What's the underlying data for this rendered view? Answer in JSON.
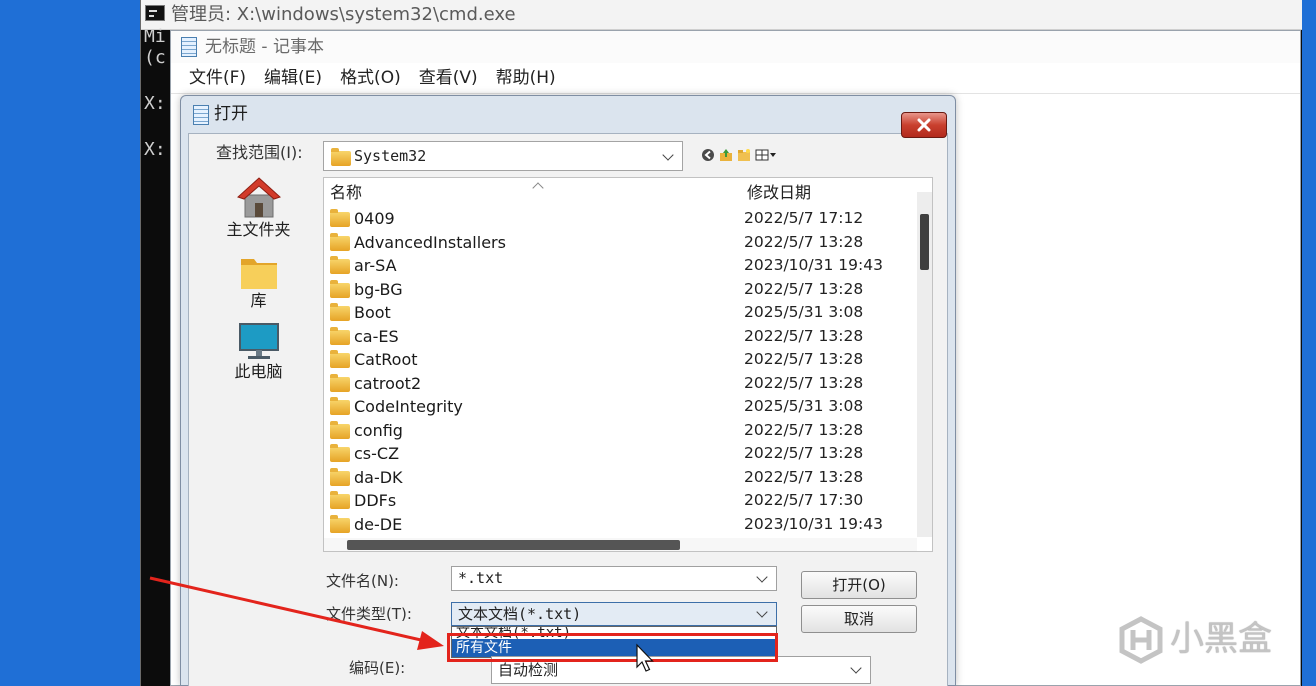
{
  "cmd": {
    "title": "管理员: X:\\windows\\system32\\cmd.exe",
    "lines": [
      "Mi",
      "(c",
      "X:",
      "X:"
    ]
  },
  "notepad": {
    "title": "无标题 - 记事本",
    "menu": [
      "文件(F)",
      "编辑(E)",
      "格式(O)",
      "查看(V)",
      "帮助(H)"
    ]
  },
  "dialog": {
    "title": "打开",
    "look_in": {
      "label": "查找范围(I):",
      "value": "System32",
      "icon": "folder-icon"
    },
    "toolbar_icons": [
      "back-icon",
      "up-folder-icon",
      "new-folder-icon",
      "view-menu-icon"
    ],
    "places": [
      {
        "label": "主文件夹",
        "icon": "home-icon"
      },
      {
        "label": "库",
        "icon": "library-icon"
      },
      {
        "label": "此电脑",
        "icon": "computer-icon"
      }
    ],
    "columns": {
      "name": "名称",
      "date": "修改日期"
    },
    "files": [
      {
        "name": "0409",
        "date": "2022/5/7 17:12"
      },
      {
        "name": "AdvancedInstallers",
        "date": "2022/5/7 13:28"
      },
      {
        "name": "ar-SA",
        "date": "2023/10/31 19:43"
      },
      {
        "name": "bg-BG",
        "date": "2022/5/7 13:28"
      },
      {
        "name": "Boot",
        "date": "2025/5/31 3:08"
      },
      {
        "name": "ca-ES",
        "date": "2022/5/7 13:28"
      },
      {
        "name": "CatRoot",
        "date": "2022/5/7 13:28"
      },
      {
        "name": "catroot2",
        "date": "2022/5/7 13:28"
      },
      {
        "name": "CodeIntegrity",
        "date": "2025/5/31 3:08"
      },
      {
        "name": "config",
        "date": "2022/5/7 13:28"
      },
      {
        "name": "cs-CZ",
        "date": "2022/5/7 13:28"
      },
      {
        "name": "da-DK",
        "date": "2022/5/7 13:28"
      },
      {
        "name": "DDFs",
        "date": "2022/5/7 17:30"
      },
      {
        "name": "de-DE",
        "date": "2023/10/31 19:43"
      }
    ],
    "file_name": {
      "label": "文件名(N):",
      "value": "*.txt"
    },
    "file_type": {
      "label": "文件类型(T):",
      "value": "文本文档(*.txt)",
      "options": [
        "文本文档(*.txt)",
        "所有文件"
      ],
      "highlighted_index": 1,
      "dropdown_open": true
    },
    "encoding": {
      "label": "编码(E):",
      "value": "自动检测"
    },
    "buttons": {
      "open": "打开(O)",
      "cancel": "取消"
    }
  },
  "watermark": {
    "text": "小黑盒",
    "icon": "xiaoheihe-logo-icon"
  },
  "colors": {
    "desktop": "#1f6fd6",
    "selection": "#1c5fb5",
    "annotation_red": "#e3241c",
    "close_button": "#c9402f"
  }
}
